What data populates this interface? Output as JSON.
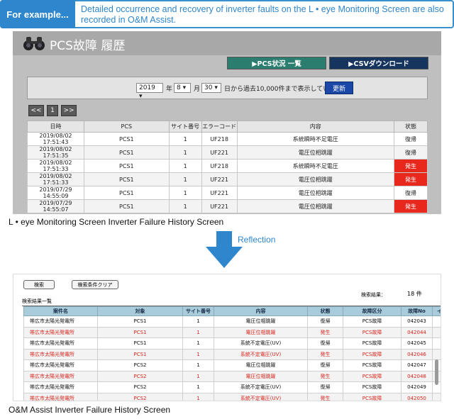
{
  "banner": {
    "tag": "For example...",
    "text": "Detailed occurrence and recovery of inverter faults on the L • eye Monitoring Screen are also recorded in O&M Assist."
  },
  "leye": {
    "title": "PCS故障 履歴",
    "buttons": {
      "pcs_list": "▶PCS状況 一覧",
      "csv_download": "▶CSVダウンロード"
    },
    "filter": {
      "year": "2019",
      "year_unit": "年",
      "month": "8",
      "month_unit": "月",
      "day": "30",
      "note": "日から過去10,000件まで表示しています。",
      "update_button": "更新"
    },
    "pager": {
      "prev": "<<",
      "page": "1",
      "next": ">>"
    },
    "columns": [
      "日時",
      "PCS",
      "サイト番号",
      "エラーコード",
      "内容",
      "状態"
    ],
    "rows": [
      {
        "datetime": "2019/08/02 17:51:43",
        "pcs": "PCS1",
        "site": "1",
        "code": "UF218",
        "content": "系統瞬時不足電圧",
        "status": "復帰",
        "alarm": false
      },
      {
        "datetime": "2019/08/02 17:51:35",
        "pcs": "PCS1",
        "site": "1",
        "code": "UF221",
        "content": "電圧位相跳躍",
        "status": "復帰",
        "alarm": false
      },
      {
        "datetime": "2019/08/02 17:51:33",
        "pcs": "PCS1",
        "site": "1",
        "code": "UF218",
        "content": "系統瞬時不足電圧",
        "status": "発生",
        "alarm": true
      },
      {
        "datetime": "2019/08/02 17:51:33",
        "pcs": "PCS1",
        "site": "1",
        "code": "UF221",
        "content": "電圧位相跳躍",
        "status": "発生",
        "alarm": true
      },
      {
        "datetime": "2019/07/29 14:55:09",
        "pcs": "PCS1",
        "site": "1",
        "code": "UF221",
        "content": "電圧位相跳躍",
        "status": "復帰",
        "alarm": false
      },
      {
        "datetime": "2019/07/29 14:55:07",
        "pcs": "PCS1",
        "site": "1",
        "code": "UF221",
        "content": "電圧位相跳躍",
        "status": "発生",
        "alarm": true
      }
    ],
    "caption": "L • eye Monitoring Screen Inverter Failure History Screen",
    "alarm_color": "#e8271d"
  },
  "reflection_label": "Reflection",
  "oma": {
    "search_button": "検索",
    "clear_button": "検索条件クリア",
    "result_label": "検索結果：",
    "result_count": "18 件",
    "list_title": "検索結果一覧",
    "columns": [
      "案件名",
      "対象",
      "サイト番号",
      "内容",
      "状態",
      "故障区分",
      "故障No",
      "インジ"
    ],
    "rows": [
      {
        "project": "帯広市太陽光発電所",
        "target": "PCS1",
        "site": "1",
        "content": "電圧位相跳躍",
        "status": "復帰",
        "category": "PCS故障",
        "no": "042043",
        "red": false
      },
      {
        "project": "帯広市太陽光発電所",
        "target": "PCS1",
        "site": "1",
        "content": "電圧位相跳躍",
        "status": "発生",
        "category": "PCS故障",
        "no": "042044",
        "red": true
      },
      {
        "project": "帯広市太陽光発電所",
        "target": "PCS1",
        "site": "1",
        "content": "系統不定電圧(UV)",
        "status": "復帰",
        "category": "PCS故障",
        "no": "042045",
        "red": false
      },
      {
        "project": "帯広市太陽光発電所",
        "target": "PCS1",
        "site": "1",
        "content": "系統不定電圧(UV)",
        "status": "発生",
        "category": "PCS故障",
        "no": "042046",
        "red": true
      },
      {
        "project": "帯広市太陽光発電所",
        "target": "PCS2",
        "site": "1",
        "content": "電圧位相跳躍",
        "status": "復帰",
        "category": "PCS故障",
        "no": "042047",
        "red": false
      },
      {
        "project": "帯広市太陽光発電所",
        "target": "PCS2",
        "site": "1",
        "content": "電圧位相跳躍",
        "status": "発生",
        "category": "PCS故障",
        "no": "042048",
        "red": true
      },
      {
        "project": "帯広市太陽光発電所",
        "target": "PCS2",
        "site": "1",
        "content": "系統不定電圧(UV)",
        "status": "復帰",
        "category": "PCS故障",
        "no": "042049",
        "red": false
      },
      {
        "project": "帯広市太陽光発電所",
        "target": "PCS2",
        "site": "1",
        "content": "系統不定電圧(UV)",
        "status": "発生",
        "category": "PCS故障",
        "no": "042050",
        "red": true
      }
    ],
    "caption": "O&M Assist Inverter Failure History Screen",
    "red_color": "#d9251c",
    "header_color": "#a8ccd9"
  }
}
